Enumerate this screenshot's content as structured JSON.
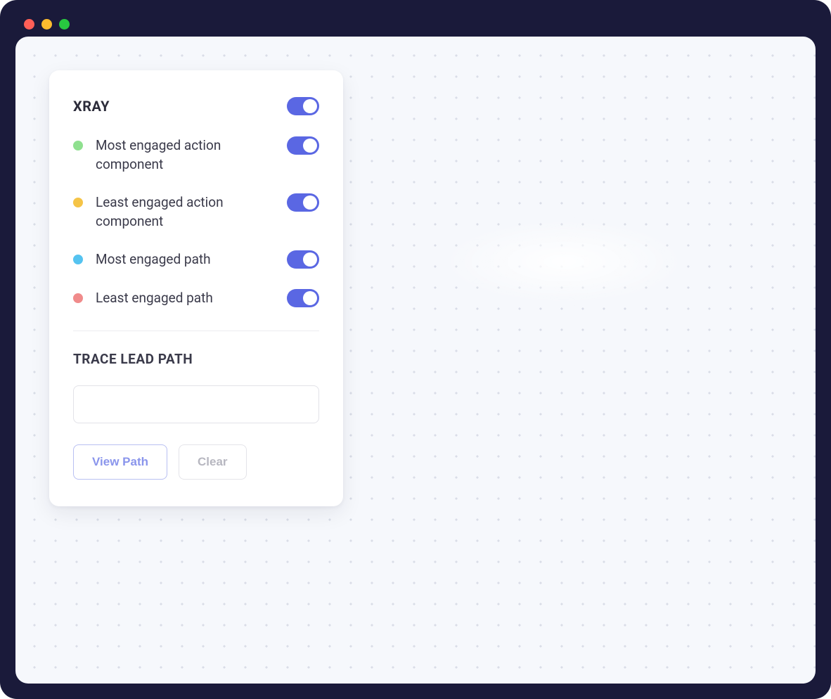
{
  "panel": {
    "title": "XRAY",
    "main_toggle_on": true,
    "options": [
      {
        "label": "Most engaged action component",
        "dot_color": "#8fe08f",
        "on": true
      },
      {
        "label": "Least engaged action component",
        "dot_color": "#f5c447",
        "on": true
      },
      {
        "label": "Most engaged path",
        "dot_color": "#55c3f0",
        "on": true
      },
      {
        "label": "Least engaged path",
        "dot_color": "#f08b8b",
        "on": true
      }
    ],
    "trace": {
      "title": "TRACE LEAD PATH",
      "input_value": "",
      "view_path_label": "View Path",
      "clear_label": "Clear"
    }
  },
  "colors": {
    "toggle_on": "#5a67e3",
    "window_bg": "#1a1a3a",
    "content_bg": "#f6f8fc"
  }
}
